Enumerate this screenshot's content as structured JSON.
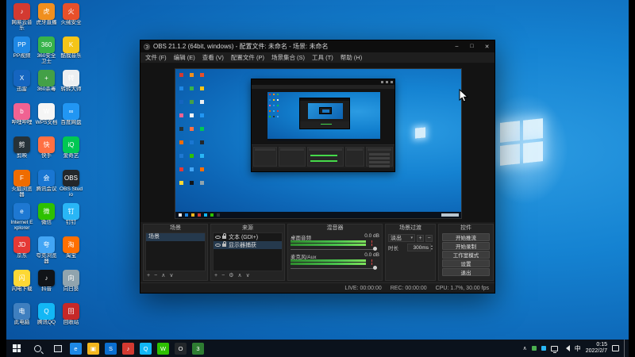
{
  "desktop": {
    "icons": [
      {
        "label": "网易云音乐",
        "color": "#d33a31",
        "glyph": "♪"
      },
      {
        "label": "虎牙直播",
        "color": "#f08f1e",
        "glyph": "虎"
      },
      {
        "label": "火绒安全",
        "color": "#e8502a",
        "glyph": "火"
      },
      {
        "label": "PP视频",
        "color": "#1e88e5",
        "glyph": "PP"
      },
      {
        "label": "360安全卫士",
        "color": "#37b34a",
        "glyph": "360"
      },
      {
        "label": "酷我音乐",
        "color": "#f5c518",
        "glyph": "K"
      },
      {
        "label": "迅雷",
        "color": "#1565c0",
        "glyph": "X"
      },
      {
        "label": "360杀毒",
        "color": "#43a047",
        "glyph": "+"
      },
      {
        "label": "转转大师",
        "color": "#eceff1",
        "glyph": "转"
      },
      {
        "label": "哔哩哔哩",
        "color": "#f06292",
        "glyph": "b"
      },
      {
        "label": "WPS文档",
        "color": "#f5f5f5",
        "glyph": "W"
      },
      {
        "label": "百度网盘",
        "color": "#2196f3",
        "glyph": "∞"
      },
      {
        "label": "剪映",
        "color": "#263238",
        "glyph": "剪"
      },
      {
        "label": "快手",
        "color": "#ff7043",
        "glyph": "快"
      },
      {
        "label": "爱奇艺",
        "color": "#00c853",
        "glyph": "iQ"
      },
      {
        "label": "火狐浏览器",
        "color": "#ef6c00",
        "glyph": "F"
      },
      {
        "label": "腾讯会议",
        "color": "#1976d2",
        "glyph": "会"
      },
      {
        "label": "OBS Studio",
        "color": "#23272b",
        "glyph": "OBS"
      },
      {
        "label": "Internet Explorer",
        "color": "#1e78d2",
        "glyph": "e"
      },
      {
        "label": "微信",
        "color": "#2dc100",
        "glyph": "微"
      },
      {
        "label": "钉钉",
        "color": "#29b6f6",
        "glyph": "钉"
      },
      {
        "label": "京东",
        "color": "#e53935",
        "glyph": "JD"
      },
      {
        "label": "夸克浏览器",
        "color": "#42a5f5",
        "glyph": "夸"
      },
      {
        "label": "淘宝",
        "color": "#ff6f00",
        "glyph": "淘"
      },
      {
        "label": "闪电下载",
        "color": "#fdd835",
        "glyph": "闪"
      },
      {
        "label": "抖音",
        "color": "#111418",
        "glyph": "♪"
      },
      {
        "label": "向日葵",
        "color": "#90a4ae",
        "glyph": "向"
      },
      {
        "label": "此电脑",
        "color": "#3f7fbf",
        "glyph": "电"
      },
      {
        "label": "腾讯QQ",
        "color": "#12b7f5",
        "glyph": "Q"
      },
      {
        "label": "回收站",
        "color": "#c62828",
        "glyph": "回"
      }
    ]
  },
  "obs": {
    "title": "OBS 21.1.2 (64bit, windows) - 配置文件: 未命名 - 场景: 未命名",
    "window_controls": {
      "minimize": "–",
      "maximize": "□",
      "close": "✕"
    },
    "menus": [
      {
        "label": "文件 (F)"
      },
      {
        "label": "编辑 (E)"
      },
      {
        "label": "查看 (V)"
      },
      {
        "label": "配置文件 (P)"
      },
      {
        "label": "场景集合 (S)"
      },
      {
        "label": "工具 (T)"
      },
      {
        "label": "帮助 (H)"
      }
    ],
    "scenes": {
      "title": "场景",
      "items": [
        {
          "name": "场景"
        }
      ],
      "toolbar": [
        {
          "glyph": "+"
        },
        {
          "glyph": "−"
        },
        {
          "glyph": "∧"
        },
        {
          "glyph": "∨"
        }
      ]
    },
    "sources": {
      "title": "来源",
      "items": [
        {
          "name": "文本 (GDI+)"
        },
        {
          "name": "显示器捕获"
        }
      ],
      "toolbar": [
        {
          "glyph": "+"
        },
        {
          "glyph": "−"
        },
        {
          "glyph": "⚙"
        },
        {
          "glyph": "∧"
        },
        {
          "glyph": "∨"
        }
      ]
    },
    "mixer": {
      "title": "混音器",
      "channels": [
        {
          "name": "桌面音频",
          "db": "0.0 dB"
        },
        {
          "name": "麦克风/Aux",
          "db": "0.0 dB"
        }
      ]
    },
    "transitions": {
      "title": "场景过渡",
      "value": "淡出",
      "add": "+",
      "remove": "−",
      "caret": "▾",
      "duration_label": "时长",
      "duration": "300ms",
      "up": "▴",
      "down": "▾"
    },
    "controls": {
      "title": "控件",
      "buttons": [
        {
          "label": "开始推流"
        },
        {
          "label": "开始录制"
        },
        {
          "label": "工作室模式"
        },
        {
          "label": "设置"
        },
        {
          "label": "退出"
        }
      ]
    },
    "status": {
      "live": "LIVE: 00:00:00",
      "rec": "REC: 00:00:00",
      "cpu": "CPU: 1.7%, 30.00 fps"
    }
  },
  "taskbar": {
    "pinned": [
      {
        "name": "edge",
        "glyph": "e",
        "color": "#1e88e5"
      },
      {
        "name": "file-explorer",
        "glyph": "▣",
        "color": "#f3b71e"
      },
      {
        "name": "store",
        "glyph": "S",
        "color": "#0b6fd0"
      },
      {
        "name": "netease-music",
        "glyph": "♪",
        "color": "#d33a31"
      },
      {
        "name": "qq",
        "glyph": "Q",
        "color": "#12b7f5"
      },
      {
        "name": "wechat",
        "glyph": "W",
        "color": "#2dc100"
      },
      {
        "name": "obs",
        "glyph": "O",
        "color": "#23272b"
      },
      {
        "name": "browser-360",
        "glyph": "3",
        "color": "#2e7d32"
      }
    ],
    "tray": {
      "chevron": "∧",
      "ime": "中",
      "time": "0:15",
      "date": "2022/2/7"
    }
  }
}
